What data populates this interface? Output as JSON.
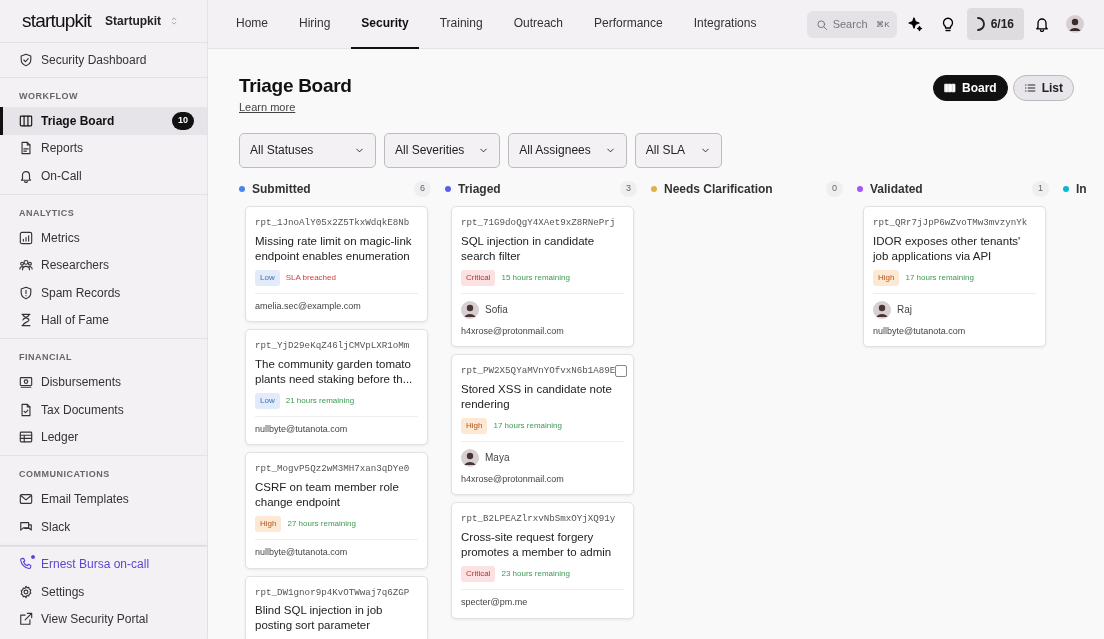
{
  "brand": {
    "logo": "startupkit",
    "workspace": "Startupkit"
  },
  "sidebar": {
    "top_item": {
      "label": "Security Dashboard",
      "selected": false
    },
    "sections": [
      {
        "heading": "WORKFLOW",
        "items": [
          {
            "label": "Triage Board",
            "selected": true,
            "badge": "10"
          },
          {
            "label": "Reports",
            "selected": false
          },
          {
            "label": "On-Call",
            "selected": false
          }
        ]
      },
      {
        "heading": "ANALYTICS",
        "items": [
          {
            "label": "Metrics",
            "selected": false
          },
          {
            "label": "Researchers",
            "selected": false
          },
          {
            "label": "Spam Records",
            "selected": false
          },
          {
            "label": "Hall of Fame",
            "selected": false
          }
        ]
      },
      {
        "heading": "FINANCIAL",
        "items": [
          {
            "label": "Disbursements",
            "selected": false
          },
          {
            "label": "Tax Documents",
            "selected": false
          },
          {
            "label": "Ledger",
            "selected": false
          }
        ]
      },
      {
        "heading": "COMMUNICATIONS",
        "items": [
          {
            "label": "Email Templates",
            "selected": false
          },
          {
            "label": "Slack",
            "selected": false
          }
        ]
      }
    ],
    "footer_items": [
      {
        "label": "Ernest Bursa on-call",
        "highlighted": true
      },
      {
        "label": "Settings",
        "highlighted": false
      },
      {
        "label": "View Security Portal",
        "highlighted": false
      }
    ]
  },
  "nav_tabs": [
    {
      "label": "Home",
      "selected": false
    },
    {
      "label": "Hiring",
      "selected": false
    },
    {
      "label": "Security",
      "selected": true
    },
    {
      "label": "Training",
      "selected": false
    },
    {
      "label": "Outreach",
      "selected": false
    },
    {
      "label": "Performance",
      "selected": false
    },
    {
      "label": "Integrations",
      "selected": false
    }
  ],
  "search": {
    "placeholder": "Search",
    "shortcut": "⌘K"
  },
  "progress": {
    "label": "6/16"
  },
  "page": {
    "title": "Triage Board",
    "link": "Learn more"
  },
  "view_toggle": [
    {
      "label": "Board",
      "selected": true
    },
    {
      "label": "List",
      "selected": false
    }
  ],
  "filters": [
    {
      "label": "All Statuses"
    },
    {
      "label": "All Severities"
    },
    {
      "label": "All Assignees"
    },
    {
      "label": "All SLA"
    }
  ],
  "columns": [
    {
      "title": "Submitted",
      "color": "#4a86e8",
      "count": "6",
      "cards": [
        {
          "id": "rpt_1JnoAlY05x2Z5TkxWdqkE8Nb",
          "title": "Missing rate limit on magic-link endpoint enables enumeration",
          "severity": {
            "label": "Low",
            "kind": "low"
          },
          "sla": {
            "label": "SLA breached",
            "breached": true
          },
          "email": "amelia.sec@example.com"
        },
        {
          "id": "rpt_YjD29eKqZ46ljCMVpLXR1oMm",
          "title": "The community garden tomato plants need staking before th...",
          "severity": {
            "label": "Low",
            "kind": "low"
          },
          "sla": {
            "label": "21 hours remaining",
            "breached": false
          },
          "email": "nullbyte@tutanota.com"
        },
        {
          "id": "rpt_MogvP5Qz2wM3MH7xan3qDYe0",
          "title": "CSRF on team member role change endpoint",
          "severity": {
            "label": "High",
            "kind": "high"
          },
          "sla": {
            "label": "27 hours remaining",
            "breached": false
          },
          "email": "nullbyte@tutanota.com"
        },
        {
          "id": "rpt_DW1gnor9p4KvOTWwaj7q6ZGP",
          "title": "Blind SQL injection in job posting sort parameter"
        }
      ]
    },
    {
      "title": "Triaged",
      "color": "#5b5fe8",
      "count": "3",
      "cards": [
        {
          "id": "rpt_71G9doQgY4XAet9xZ8RNePrj",
          "title": "SQL injection in candidate search filter",
          "severity": {
            "label": "Critical",
            "kind": "critical"
          },
          "sla": {
            "label": "15 hours remaining",
            "breached": false
          },
          "assignee": "Sofia",
          "email": "h4xrose@protonmail.com"
        },
        {
          "id": "rpt_PW2X5QYaMVnYOfvxN6b1A89E",
          "title": "Stored XSS in candidate note rendering",
          "checked": false,
          "severity": {
            "label": "High",
            "kind": "high"
          },
          "sla": {
            "label": "17 hours remaining",
            "breached": false
          },
          "assignee": "Maya",
          "email": "h4xrose@protonmail.com"
        },
        {
          "id": "rpt_B2LPEAZlrxvNbSmxOYjXQ91y",
          "title": "Cross-site request forgery promotes a member to admin",
          "severity": {
            "label": "Critical",
            "kind": "critical"
          },
          "sla": {
            "label": "23 hours remaining",
            "breached": false
          },
          "email": "specter@pm.me"
        }
      ]
    },
    {
      "title": "Needs Clarification",
      "color": "#e0b04a",
      "count": "0"
    },
    {
      "title": "Validated",
      "color": "#a855f7",
      "count": "1",
      "cards": [
        {
          "id": "rpt_QRr7jJpP6wZvoTMw3mvzynYk",
          "title": "IDOR exposes other tenants' job applications via API",
          "severity": {
            "label": "High",
            "kind": "high"
          },
          "sla": {
            "label": "17 hours remaining",
            "breached": false
          },
          "assignee": "Raj",
          "email": "nullbyte@tutanota.com"
        }
      ]
    },
    {
      "title": "In",
      "color": "#06b6d4"
    }
  ]
}
